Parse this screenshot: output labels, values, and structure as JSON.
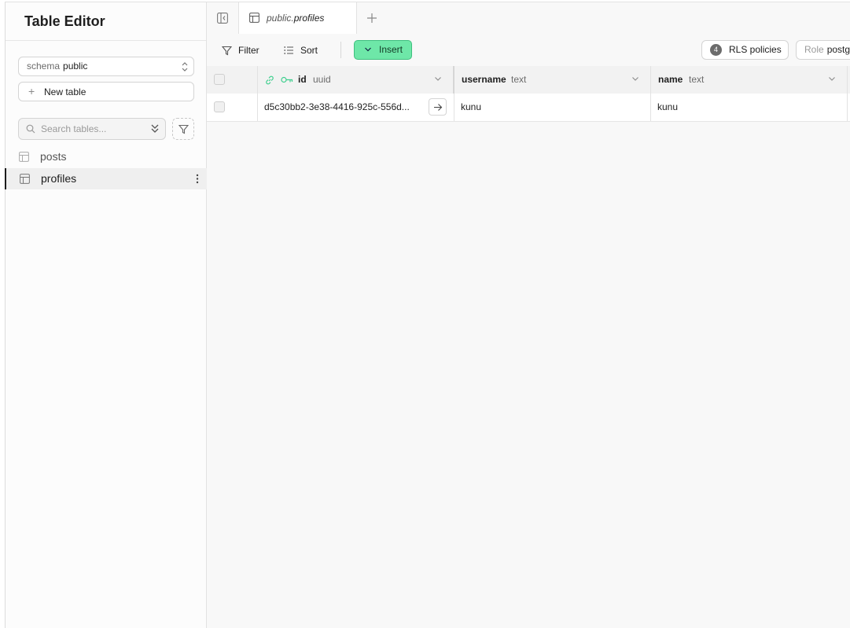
{
  "sidebar": {
    "title": "Table Editor",
    "schema_label": "schema",
    "schema_value": "public",
    "new_table_label": "New table",
    "search_placeholder": "Search tables...",
    "tables": [
      {
        "label": "posts"
      },
      {
        "label": "profiles"
      }
    ]
  },
  "tabs": {
    "active_schema": "public.",
    "active_table": "profiles"
  },
  "toolbar": {
    "filter_label": "Filter",
    "sort_label": "Sort",
    "insert_label": "Insert",
    "rls_count": "4",
    "rls_label": "RLS policies",
    "role_label": "Role",
    "role_value": "postgres"
  },
  "grid": {
    "columns": [
      {
        "name": "id",
        "type": "uuid"
      },
      {
        "name": "username",
        "type": "text"
      },
      {
        "name": "name",
        "type": "text"
      }
    ],
    "rows": [
      {
        "id": "d5c30bb2-3e38-4416-925c-556d...",
        "username": "kunu",
        "name": "kunu"
      }
    ]
  },
  "colors": {
    "accent": "#6ee7a8",
    "accent_border": "#3fbf7f",
    "key_icon": "#3ecf8e"
  }
}
